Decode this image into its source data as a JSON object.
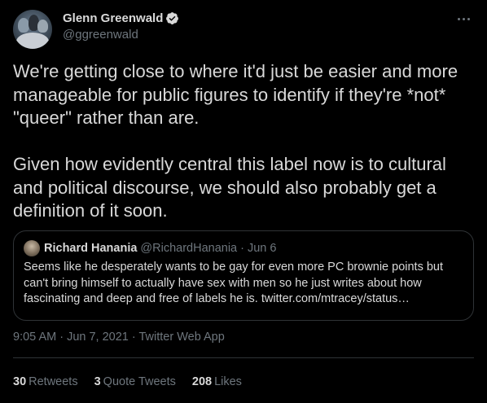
{
  "author": {
    "display_name": "Glenn Greenwald",
    "handle": "@ggreenwald",
    "verified": true
  },
  "tweet": {
    "text": "We're getting close to where it'd just be easier and more manageable for public figures to identify if they're *not* \"queer\" rather than are.\n\nGiven how evidently central this label now is to cultural and political discourse, we should also probably get a definition of it soon.",
    "timestamp": "9:05 AM · Jun 7, 2021 · Twitter Web App"
  },
  "quoted_tweet": {
    "display_name": "Richard Hanania",
    "handle": "@RichardHanania",
    "separator": "·",
    "date": "Jun 6",
    "text": "Seems like he desperately wants to be gay for even more PC brownie points but can't bring himself to actually have sex with men so he just writes about how fascinating and deep and free of labels he is. twitter.com/mtracey/status…"
  },
  "stats": {
    "retweets_count": "30",
    "retweets_label": "Retweets",
    "quotes_count": "3",
    "quotes_label": "Quote Tweets",
    "likes_count": "208",
    "likes_label": "Likes"
  },
  "colors": {
    "background": "#000000",
    "text": "#d9d9d9",
    "secondary": "#6e767d",
    "border": "#2f3336",
    "verified": "#d9d9d9"
  },
  "icons": {
    "verified": "verified-badge-icon",
    "more": "more-horizontal-icon"
  }
}
